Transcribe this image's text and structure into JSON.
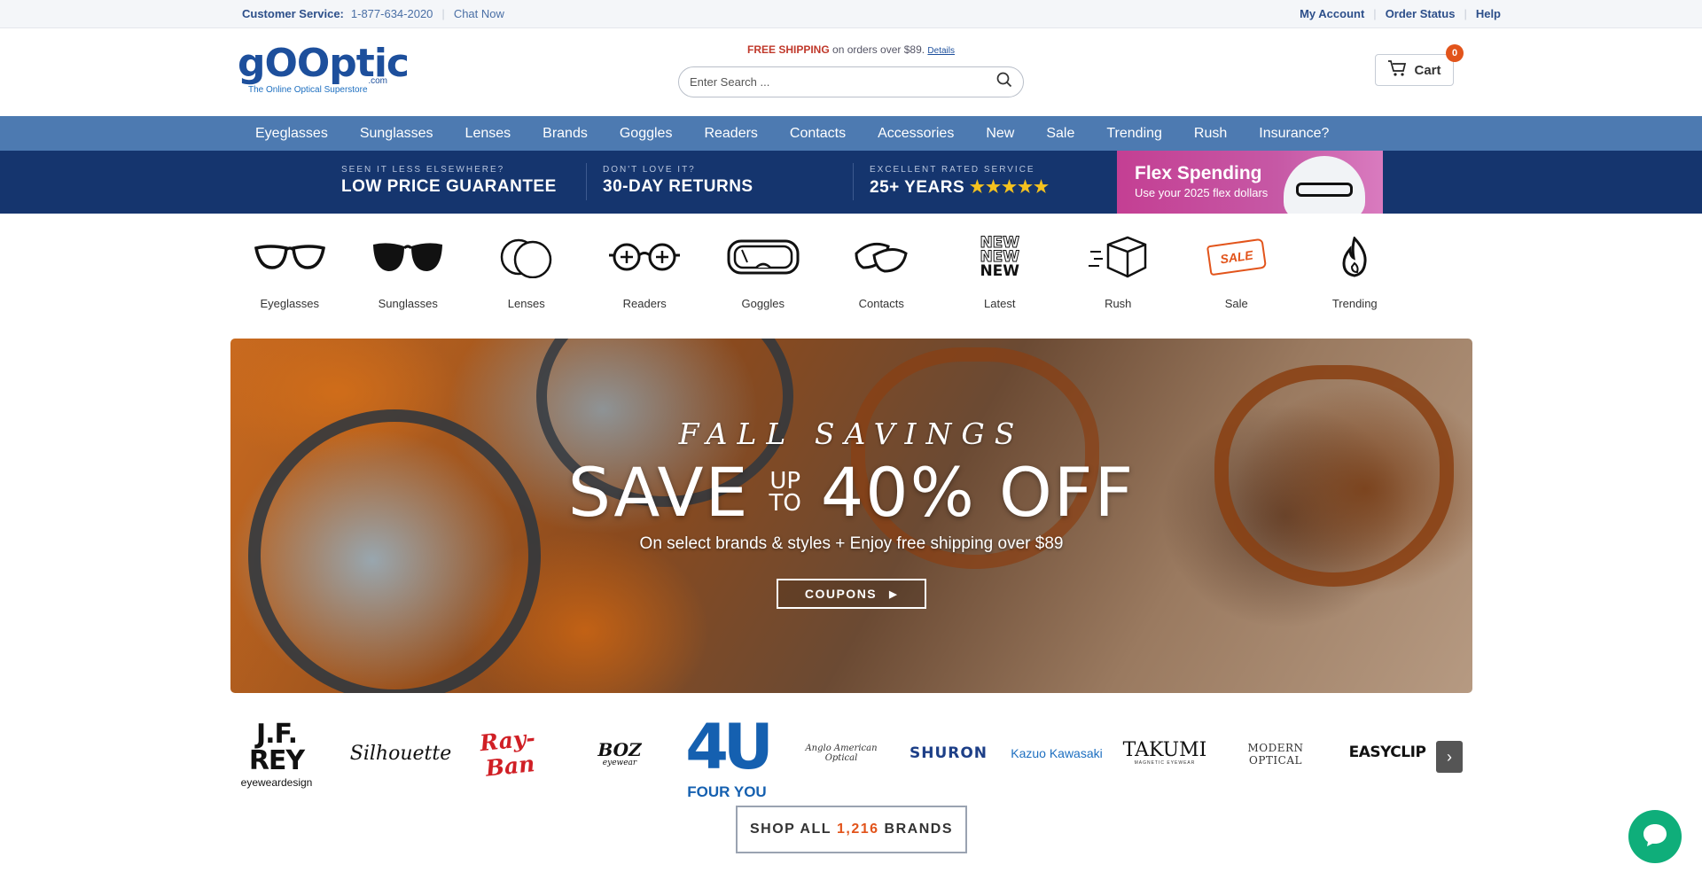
{
  "topbar": {
    "customer_service_label": "Customer Service:",
    "phone": "1-877-634-2020",
    "chat": "Chat Now",
    "links": [
      "My Account",
      "Order Status",
      "Help"
    ]
  },
  "header": {
    "logo": {
      "name": "gOOptic",
      "com": ".com",
      "tagline": "The Online Optical Superstore"
    },
    "shipping": {
      "highlight": "FREE SHIPPING",
      "text": "on orders over $89.",
      "details": "Details"
    },
    "search": {
      "placeholder": "Enter Search ..."
    },
    "cart": {
      "label": "Cart",
      "count": "0"
    }
  },
  "nav": {
    "items": [
      "Eyeglasses",
      "Sunglasses",
      "Lenses",
      "Brands",
      "Goggles",
      "Readers",
      "Contacts",
      "Accessories",
      "New",
      "Sale",
      "Trending",
      "Rush",
      "Insurance?"
    ]
  },
  "promo": {
    "blocks": [
      {
        "small": "SEEN IT LESS ELSEWHERE?",
        "big": "LOW PRICE GUARANTEE"
      },
      {
        "small": "DON'T LOVE IT?",
        "big": "30-DAY RETURNS"
      },
      {
        "small": "EXCELLENT RATED SERVICE",
        "big": "25+ YEARS",
        "stars": "★★★★★"
      }
    ],
    "flex": {
      "title": "Flex Spending",
      "subtitle": "Use your 2025 flex dollars"
    }
  },
  "categories": [
    {
      "label": "Eyeglasses",
      "icon": "eyeglasses-icon"
    },
    {
      "label": "Sunglasses",
      "icon": "sunglasses-icon"
    },
    {
      "label": "Lenses",
      "icon": "lenses-icon"
    },
    {
      "label": "Readers",
      "icon": "readers-icon"
    },
    {
      "label": "Goggles",
      "icon": "goggles-icon"
    },
    {
      "label": "Contacts",
      "icon": "contacts-icon"
    },
    {
      "label": "Latest",
      "icon": "new-icon",
      "icon_text": [
        "NEW",
        "NEW",
        "NEW"
      ]
    },
    {
      "label": "Rush",
      "icon": "box-icon"
    },
    {
      "label": "Sale",
      "icon": "sale-tag-icon",
      "icon_text": "SALE"
    },
    {
      "label": "Trending",
      "icon": "flame-icon"
    }
  ],
  "hero": {
    "kicker": "FALL SAVINGS",
    "save": "SAVE",
    "up": "UP",
    "to": "TO",
    "percent": "40% OFF",
    "subtitle": "On select brands & styles + Enjoy free shipping over $89",
    "cta": "COUPONS"
  },
  "brands": {
    "items": [
      "J.F. REY",
      "eyeweardesign",
      "Silhouette",
      "Ray-Ban",
      "BOZ",
      "eyewear",
      "4U",
      "FOUR YOU",
      "Anglo American Optical",
      "SHURON",
      "Kazuo Kawasaki",
      "TAKUMI",
      "MAGNETIC EYEWEAR",
      "MODERN OPTICAL",
      "EASYCLIP"
    ],
    "shop_all_prefix": "SHOP ALL",
    "count": "1,216",
    "shop_all_suffix": "BRANDS"
  },
  "colors": {
    "nav_bg": "#4d7ab1",
    "promo_bg": "#15356e",
    "accent": "#e2541b",
    "chat": "#0fae7a"
  }
}
